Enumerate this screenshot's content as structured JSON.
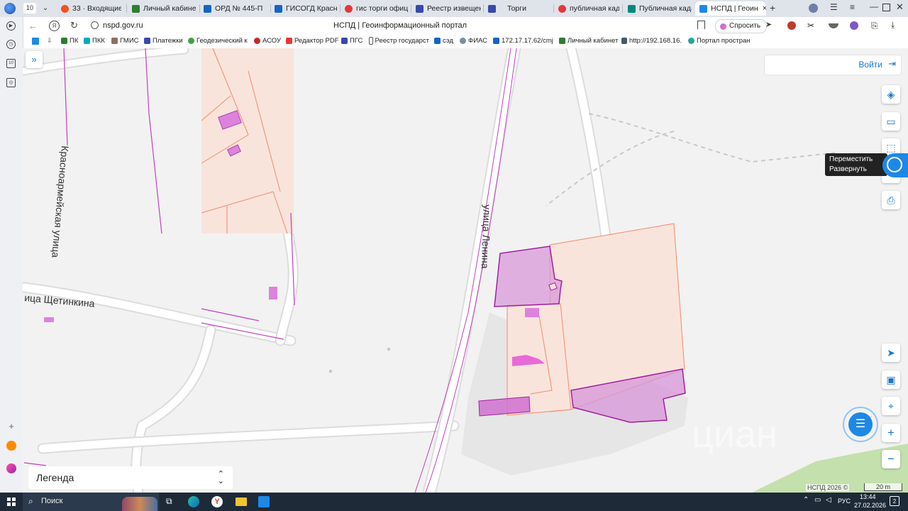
{
  "browser": {
    "tab_counter": "10",
    "tabs": [
      {
        "label": "33 · Входящие —",
        "color": "#f4511e"
      },
      {
        "label": "Личный кабинет",
        "color": "#2e7d32"
      },
      {
        "label": "ОРД № 445-П",
        "color": "#1565c0"
      },
      {
        "label": "ГИСОГД Красно",
        "color": "#1565c0"
      },
      {
        "label": "гис торги офици",
        "color": "#e53935"
      },
      {
        "label": "Реестр извещени",
        "color": "#3949ab"
      },
      {
        "label": "Торги",
        "color": "#3949ab"
      },
      {
        "label": "публичная када",
        "color": "#e53935"
      },
      {
        "label": "Публичная када",
        "color": "#00897b"
      },
      {
        "label": "НСПД | Геоин",
        "color": "#1e88e5"
      }
    ],
    "url": "nspd.gov.ru",
    "page_title": "НСПД | Геоинформационный портал",
    "ask_label": "Спросить",
    "bookmarks": [
      "ПК",
      "ПКК",
      "ГМИС",
      "Платежки",
      "Геодезический к",
      "АСОУ",
      "Редактор PDF",
      "ПГС",
      "Реестр государст",
      "сэд",
      "ФИАС",
      "172.17.17.62/cmj",
      "Личный кабинет",
      "http://192.168.16.",
      "Портал простран"
    ]
  },
  "map": {
    "login_label": "Войти",
    "tooltip_line1": "Переместить",
    "tooltip_line2": "Развернуть",
    "streets": {
      "krasnoarmeyskaya": "Красноармейская улица",
      "shchetinkina": "ица Щетинкина",
      "lenina": "улица Ленина"
    },
    "legend_label": "Легенда",
    "attribution": "НСПД 2026 ©",
    "scale_label": "20 m",
    "watermark": "циан",
    "zoom_in": "+",
    "zoom_out": "−"
  },
  "taskbar": {
    "search_label": "Поиск",
    "lang": "РУС",
    "time": "13:44",
    "date": "27.02.2026",
    "notifications": "2"
  }
}
